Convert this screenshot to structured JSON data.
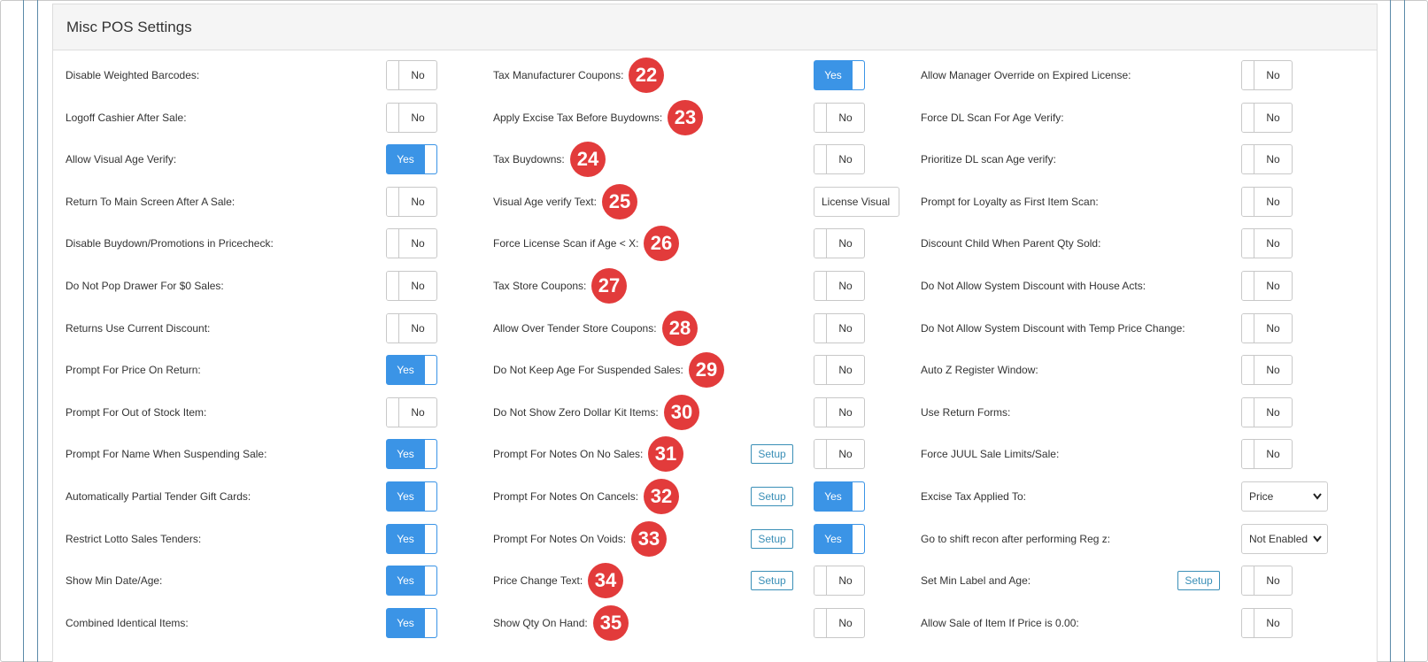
{
  "panel": {
    "title": "Misc POS Settings"
  },
  "rows": [
    {
      "col1": {
        "label": "Disable Weighted Barcodes:",
        "value": "No",
        "on": false
      },
      "col2": {
        "label": "Tax Manufacturer Coupons:",
        "badge": "22",
        "value": "Yes",
        "on": true
      },
      "col3": {
        "label": "Allow Manager Override on Expired License:",
        "value": "No",
        "on": false
      }
    },
    {
      "col1": {
        "label": "Logoff Cashier After Sale:",
        "value": "No",
        "on": false
      },
      "col2": {
        "label": "Apply Excise Tax Before Buydowns:",
        "badge": "23",
        "value": "No",
        "on": false
      },
      "col3": {
        "label": "Force DL Scan For Age Verify:",
        "value": "No",
        "on": false
      }
    },
    {
      "col1": {
        "label": "Allow Visual Age Verify:",
        "value": "Yes",
        "on": true
      },
      "col2": {
        "label": "Tax Buydowns:",
        "badge": "24",
        "value": "No",
        "on": false
      },
      "col3": {
        "label": "Prioritize DL scan Age verify:",
        "value": "No",
        "on": false
      }
    },
    {
      "col1": {
        "label": "Return To Main Screen After A Sale:",
        "value": "No",
        "on": false
      },
      "col2": {
        "label": "Visual Age verify Text:",
        "badge": "25",
        "input_value": "License Visual"
      },
      "col3": {
        "label": "Prompt for Loyalty as First Item Scan:",
        "value": "No",
        "on": false
      }
    },
    {
      "col1": {
        "label": "Disable Buydown/Promotions in Pricecheck:",
        "value": "No",
        "on": false
      },
      "col2": {
        "label": "Force License Scan if Age < X:",
        "badge": "26",
        "value": "No",
        "on": false
      },
      "col3": {
        "label": "Discount Child When Parent Qty Sold:",
        "value": "No",
        "on": false
      }
    },
    {
      "col1": {
        "label": "Do Not Pop Drawer For $0 Sales:",
        "value": "No",
        "on": false
      },
      "col2": {
        "label": "Tax Store Coupons:",
        "badge": "27",
        "value": "No",
        "on": false
      },
      "col3": {
        "label": "Do Not Allow System Discount with House Acts:",
        "value": "No",
        "on": false
      }
    },
    {
      "col1": {
        "label": "Returns Use Current Discount:",
        "value": "No",
        "on": false
      },
      "col2": {
        "label": "Allow Over Tender Store Coupons:",
        "badge": "28",
        "value": "No",
        "on": false
      },
      "col3": {
        "label": "Do Not Allow System Discount with Temp Price Change:",
        "value": "No",
        "on": false
      }
    },
    {
      "col1": {
        "label": "Prompt For Price On Return:",
        "value": "Yes",
        "on": true
      },
      "col2": {
        "label": "Do Not Keep Age For Suspended Sales:",
        "badge": "29",
        "value": "No",
        "on": false
      },
      "col3": {
        "label": "Auto Z Register Window:",
        "value": "No",
        "on": false
      }
    },
    {
      "col1": {
        "label": "Prompt For Out of Stock Item:",
        "value": "No",
        "on": false
      },
      "col2": {
        "label": "Do Not Show Zero Dollar Kit Items:",
        "badge": "30",
        "value": "No",
        "on": false
      },
      "col3": {
        "label": "Use Return Forms:",
        "value": "No",
        "on": false
      }
    },
    {
      "col1": {
        "label": "Prompt For Name When Suspending Sale:",
        "value": "Yes",
        "on": true
      },
      "col2": {
        "label": "Prompt For Notes On No Sales:",
        "badge": "31",
        "setup": "Setup",
        "value": "No",
        "on": false
      },
      "col3": {
        "label": "Force JUUL Sale Limits/Sale:",
        "value": "No",
        "on": false
      }
    },
    {
      "col1": {
        "label": "Automatically Partial Tender Gift Cards:",
        "value": "Yes",
        "on": true
      },
      "col2": {
        "label": "Prompt For Notes On Cancels:",
        "badge": "32",
        "setup": "Setup",
        "value": "Yes",
        "on": true
      },
      "col3": {
        "label": "Excise Tax Applied To:",
        "select_value": "Price"
      }
    },
    {
      "col1": {
        "label": "Restrict Lotto Sales Tenders:",
        "value": "Yes",
        "on": true
      },
      "col2": {
        "label": "Prompt For Notes On Voids:",
        "badge": "33",
        "setup": "Setup",
        "value": "Yes",
        "on": true
      },
      "col3": {
        "label": "Go to shift recon after performing Reg z:",
        "select_value": "Not Enabled"
      }
    },
    {
      "col1": {
        "label": "Show Min Date/Age:",
        "value": "Yes",
        "on": true
      },
      "col2": {
        "label": "Price Change Text:",
        "badge": "34",
        "setup": "Setup",
        "value": "No",
        "on": false
      },
      "col3": {
        "label": "Set Min Label and Age:",
        "setup": "Setup",
        "value": "No",
        "on": false
      }
    },
    {
      "col1": {
        "label": "Combined Identical Items:",
        "value": "Yes",
        "on": true
      },
      "col2": {
        "label": "Show Qty On Hand:",
        "badge": "35",
        "value": "No",
        "on": false
      },
      "col3": {
        "label": "Allow Sale of Item If Price is 0.00:",
        "value": "No",
        "on": false
      }
    }
  ]
}
